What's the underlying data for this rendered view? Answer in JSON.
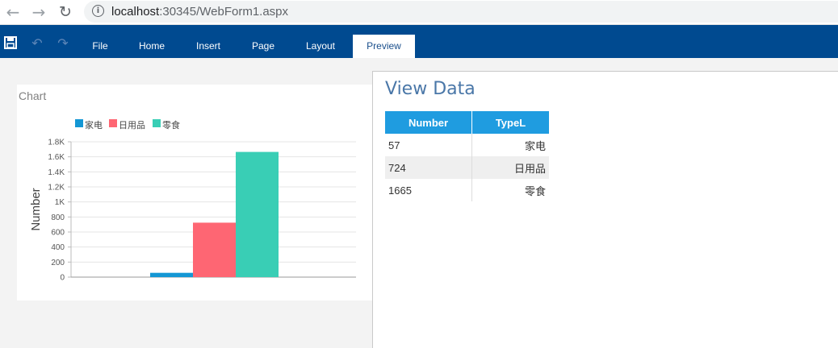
{
  "browser": {
    "url_host": "localhost",
    "url_path": ":30345/WebForm1.aspx"
  },
  "ribbon": {
    "tabs": [
      {
        "label": "File"
      },
      {
        "label": "Home"
      },
      {
        "label": "Insert"
      },
      {
        "label": "Page"
      },
      {
        "label": "Layout"
      },
      {
        "label": "Preview",
        "active": true
      }
    ],
    "icons": [
      "save-icon",
      "undo-icon",
      "redo-icon"
    ]
  },
  "chart_panel": {
    "title": "Chart"
  },
  "chart_data": {
    "type": "bar",
    "ylabel": "Number",
    "ylim": [
      0,
      1800
    ],
    "yticks": [
      "0",
      "200",
      "400",
      "600",
      "800",
      "1K",
      "1.2K",
      "1.4K",
      "1.6K",
      "1.8K"
    ],
    "grid": true,
    "legend_position": "top-left",
    "series": [
      {
        "name": "家电",
        "value": 57,
        "color": "#1497d4"
      },
      {
        "name": "日用品",
        "value": 724,
        "color": "#fe6673"
      },
      {
        "name": "零食",
        "value": 1665,
        "color": "#39ceb5"
      }
    ]
  },
  "data_view": {
    "title": "View Data",
    "columns": [
      "Number",
      "TypeL"
    ],
    "rows": [
      [
        "57",
        "家电"
      ],
      [
        "724",
        "日用品"
      ],
      [
        "1665",
        "零食"
      ]
    ]
  }
}
